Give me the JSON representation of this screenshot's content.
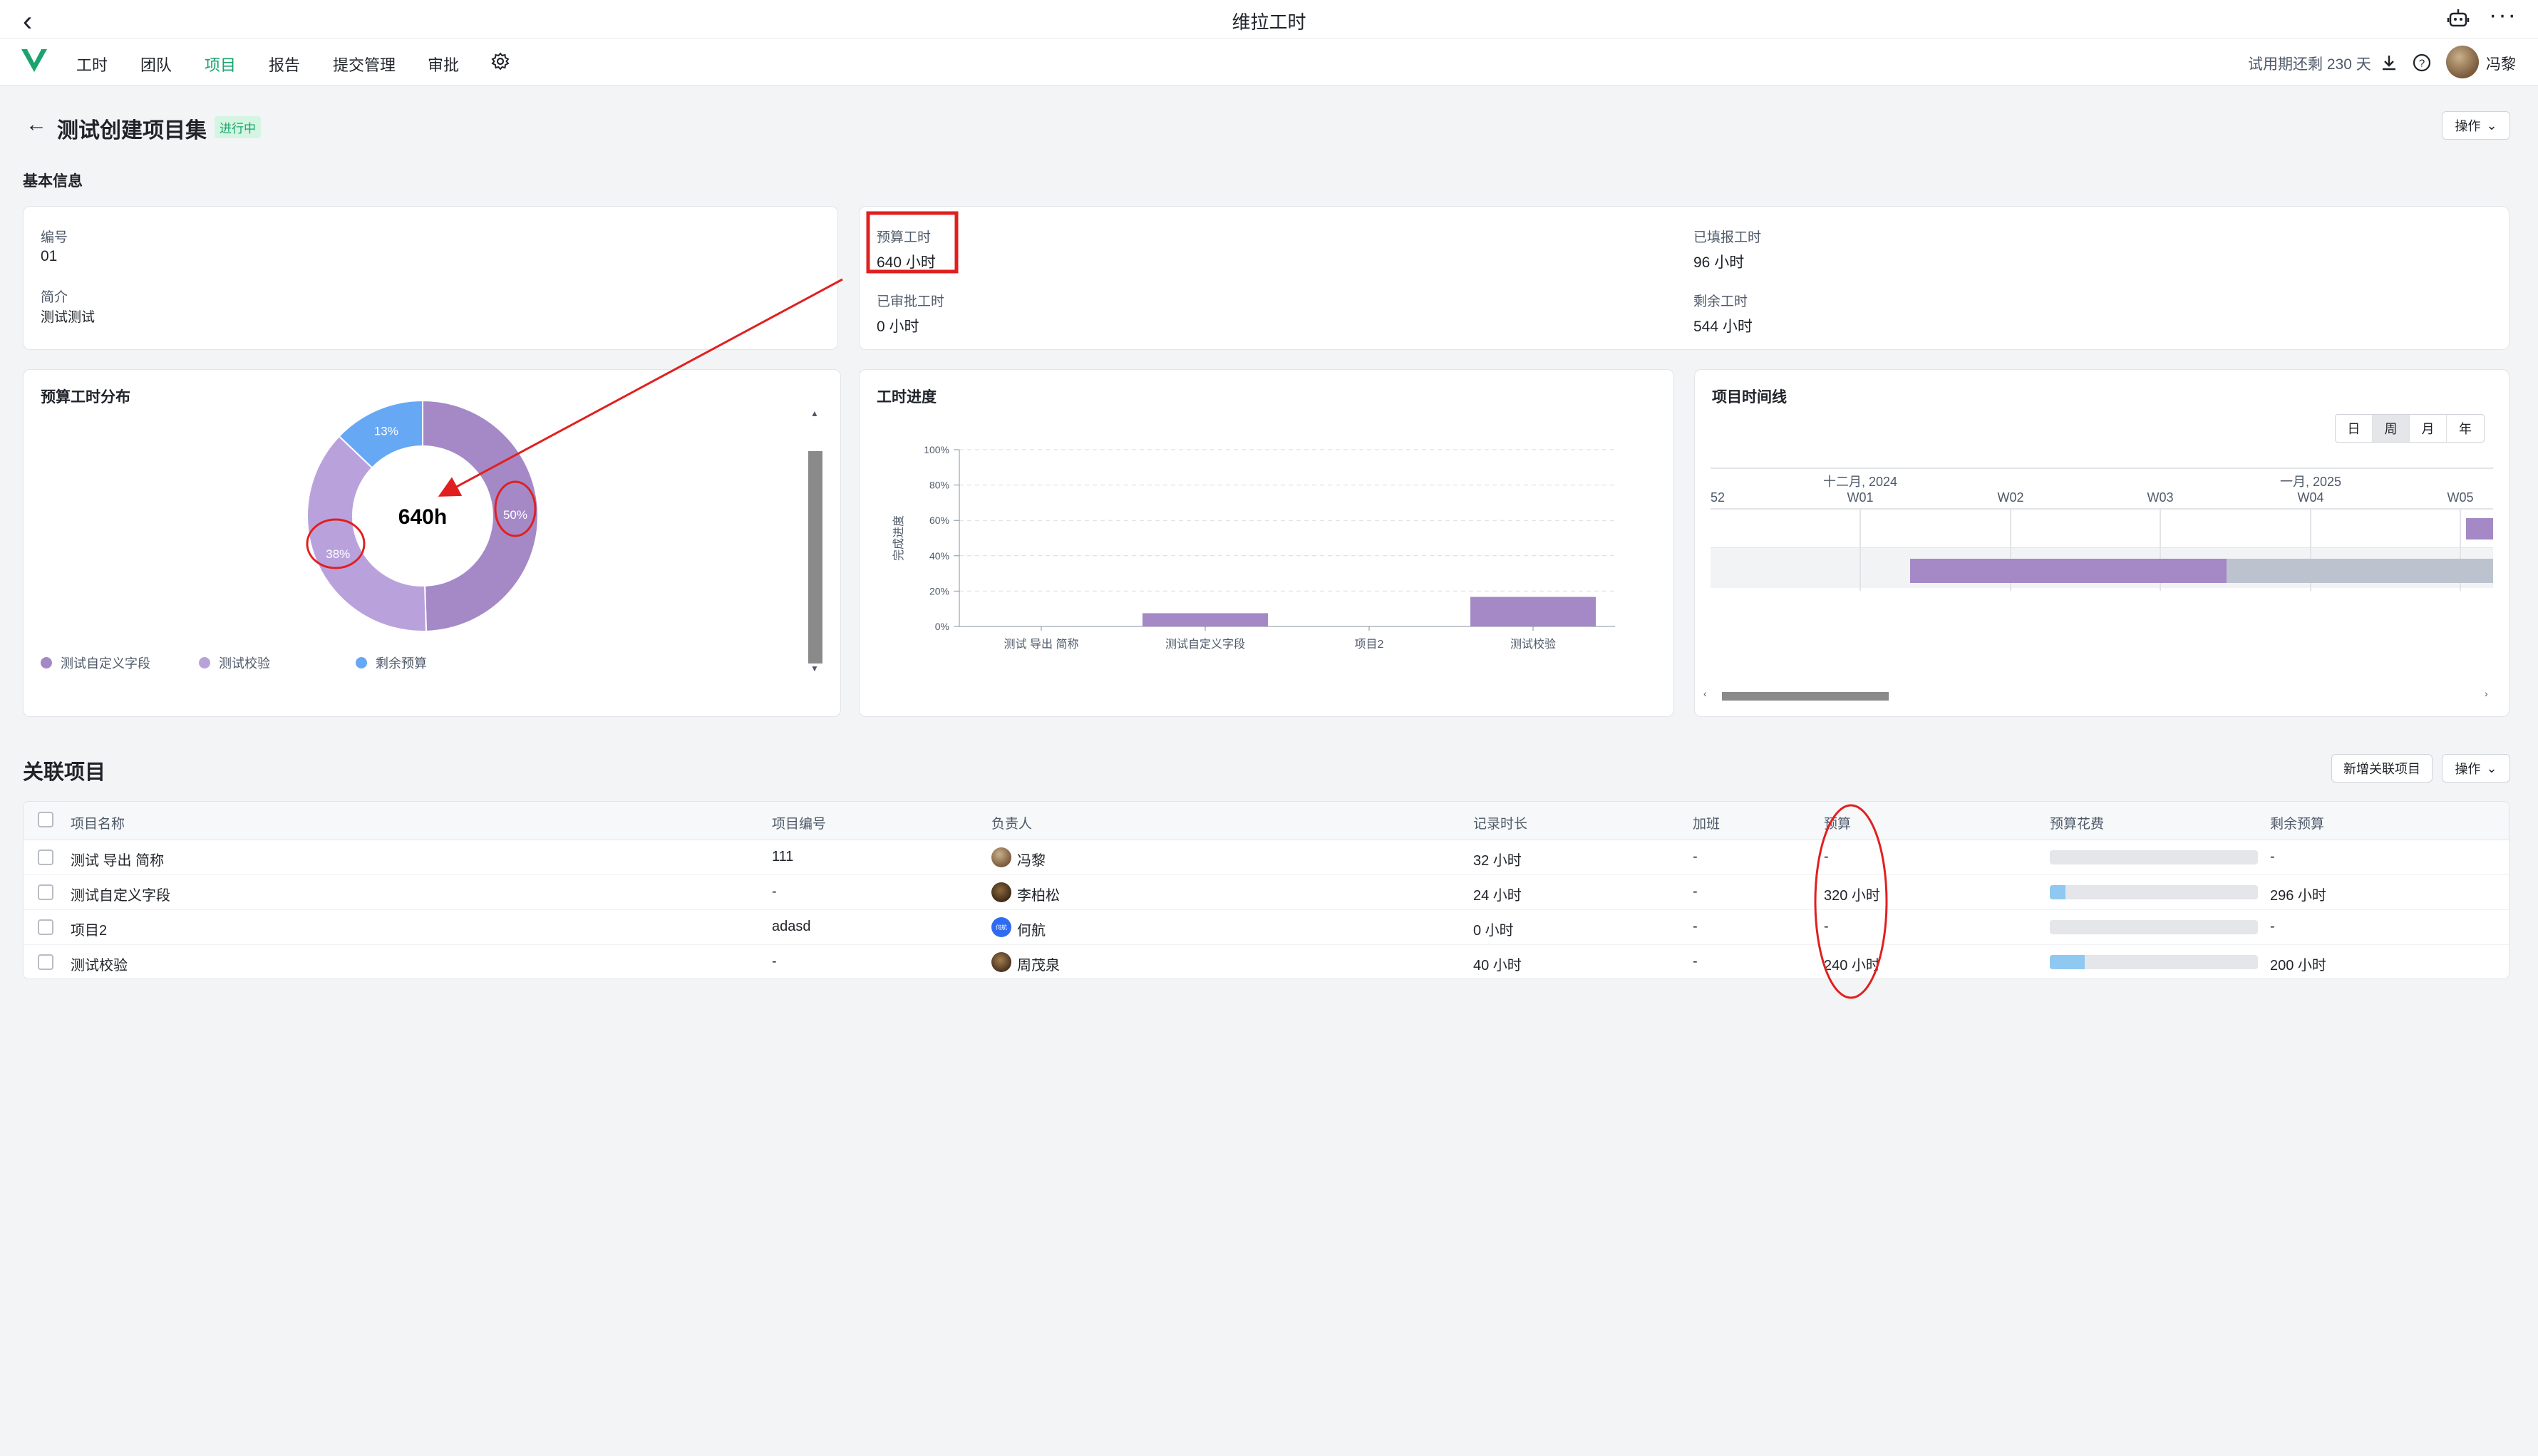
{
  "window": {
    "title": "维拉工时"
  },
  "nav": {
    "items": [
      "工时",
      "团队",
      "项目",
      "报告",
      "提交管理",
      "审批"
    ],
    "active_item": "项目",
    "trial_text": "试用期还剩 230 天",
    "user_name": "冯黎"
  },
  "page": {
    "title": "测试创建项目集",
    "status": "进行中",
    "action_label": "操作",
    "section_basic": "基本信息"
  },
  "basic_info": {
    "code_label": "编号",
    "code_value": "01",
    "intro_label": "简介",
    "intro_value": "测试测试",
    "budget_label": "预算工时",
    "budget_value": "640 小时",
    "filled_label": "已填报工时",
    "filled_value": "96 小时",
    "approved_label": "已审批工时",
    "approved_value": "0 小时",
    "remaining_label": "剩余工时",
    "remaining_value": "544 小时"
  },
  "donut_card": {
    "title": "预算工时分布",
    "center_text": "640h",
    "legend": [
      "测试自定义字段",
      "测试校验",
      "剩余预算"
    ]
  },
  "progress_card": {
    "title": "工时进度"
  },
  "timeline_card": {
    "title": "项目时间线",
    "views": [
      "日",
      "周",
      "月",
      "年"
    ],
    "active_view": "周",
    "month_labels": [
      "十二月, 2024",
      "一月, 2025"
    ],
    "week_labels": [
      "52",
      "W01",
      "W02",
      "W03",
      "W04",
      "W05"
    ]
  },
  "related": {
    "title": "关联项目",
    "add_button": "新增关联项目",
    "action_label": "操作",
    "columns": [
      "项目名称",
      "项目编号",
      "负责人",
      "记录时长",
      "加班",
      "预算",
      "预算花费",
      "剩余预算"
    ],
    "rows": [
      {
        "name": "测试 导出 简称",
        "code": "111",
        "owner": "冯黎",
        "logged": "32 小时",
        "overtime": "-",
        "budget": "-",
        "spent_ratio": 0,
        "remaining": "-"
      },
      {
        "name": "测试自定义字段",
        "code": "-",
        "owner": "李柏松",
        "logged": "24 小时",
        "overtime": "-",
        "budget": "320 小时",
        "spent_ratio": 0.075,
        "remaining": "296 小时"
      },
      {
        "name": "项目2",
        "code": "adasd",
        "owner": "何航",
        "logged": "0 小时",
        "overtime": "-",
        "budget": "-",
        "spent_ratio": 0,
        "remaining": "-"
      },
      {
        "name": "测试校验",
        "code": "-",
        "owner": "周茂泉",
        "logged": "40 小时",
        "overtime": "-",
        "budget": "240 小时",
        "spent_ratio": 0.167,
        "remaining": "200 小时"
      }
    ],
    "owner_avatar_text": "何航"
  },
  "chart_data": [
    {
      "type": "pie",
      "title": "预算工时分布",
      "center_label": "640h",
      "categories": [
        "测试自定义字段",
        "测试校验",
        "剩余预算"
      ],
      "values": [
        50,
        38,
        13
      ],
      "value_labels": [
        "50%",
        "38%",
        "13%"
      ],
      "colors": [
        "#a489c6",
        "#b9a2dc",
        "#67a8f5"
      ]
    },
    {
      "type": "bar",
      "title": "工时进度",
      "categories": [
        "测试 导出 简称",
        "测试自定义字段",
        "项目2",
        "测试校验"
      ],
      "values": [
        0,
        7.5,
        0,
        16.7
      ],
      "ylabel": "完成进度",
      "ylim": [
        0,
        100
      ],
      "yticks": [
        "0%",
        "20%",
        "40%",
        "60%",
        "80%",
        "100%"
      ],
      "color": "#a489c6"
    }
  ]
}
